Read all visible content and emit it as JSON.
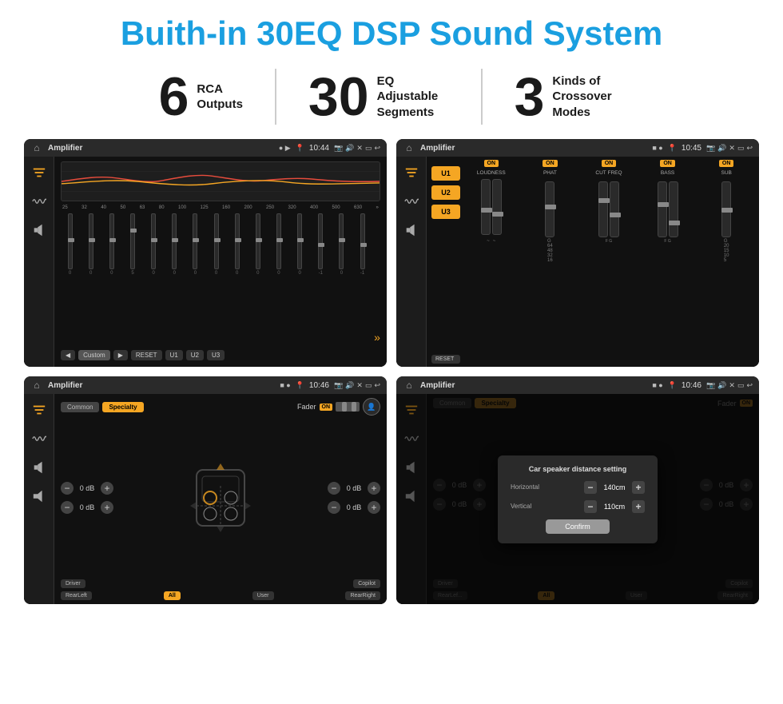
{
  "header": {
    "title": "Buith-in 30EQ DSP Sound System"
  },
  "stats": [
    {
      "number": "6",
      "label": "RCA\nOutputs"
    },
    {
      "number": "30",
      "label": "EQ Adjustable\nSegments"
    },
    {
      "number": "3",
      "label": "Kinds of\nCrossover Modes"
    }
  ],
  "screens": [
    {
      "id": "eq-screen",
      "status_bar": {
        "title": "Amplifier",
        "time": "10:44"
      },
      "eq_presets": [
        "Custom",
        "RESET",
        "U1",
        "U2",
        "U3"
      ],
      "freq_labels": [
        "25",
        "32",
        "40",
        "50",
        "63",
        "80",
        "100",
        "125",
        "160",
        "200",
        "250",
        "320",
        "400",
        "500",
        "630"
      ],
      "slider_values": [
        "0",
        "0",
        "0",
        "5",
        "0",
        "0",
        "0",
        "0",
        "0",
        "0",
        "0",
        "0",
        "-1",
        "0",
        "-1"
      ]
    },
    {
      "id": "crossover-screen",
      "status_bar": {
        "title": "Amplifier",
        "time": "10:45"
      },
      "presets": [
        "U1",
        "U2",
        "U3"
      ],
      "controls": [
        {
          "label": "LOUDNESS",
          "value": "ON"
        },
        {
          "label": "PHAT",
          "value": "ON"
        },
        {
          "label": "CUT FREQ",
          "value": "ON"
        },
        {
          "label": "BASS",
          "value": "ON"
        },
        {
          "label": "SUB",
          "value": "ON"
        }
      ],
      "reset_label": "RESET"
    },
    {
      "id": "fader-screen",
      "status_bar": {
        "title": "Amplifier",
        "time": "10:46"
      },
      "tabs": [
        "Common",
        "Specialty"
      ],
      "fader_label": "Fader",
      "fader_toggle": "ON",
      "speakers": [
        {
          "label": "0 dB"
        },
        {
          "label": "0 dB"
        },
        {
          "label": "0 dB"
        },
        {
          "label": "0 dB"
        }
      ],
      "buttons": {
        "driver": "Driver",
        "copilot": "Copilot",
        "rear_left": "RearLeft",
        "all": "All",
        "user": "User",
        "rear_right": "RearRight"
      }
    },
    {
      "id": "dialog-screen",
      "status_bar": {
        "title": "Amplifier",
        "time": "10:46"
      },
      "tabs": [
        "Common",
        "Specialty"
      ],
      "dialog": {
        "title": "Car speaker distance setting",
        "horizontal_label": "Horizontal",
        "horizontal_value": "140cm",
        "vertical_label": "Vertical",
        "vertical_value": "110cm",
        "confirm_label": "Confirm"
      },
      "buttons": {
        "driver": "Driver",
        "copilot": "Copilot",
        "rear_left": "RearLef...",
        "all": "All",
        "user": "User",
        "rear_right": "RearRight"
      }
    }
  ],
  "colors": {
    "accent": "#f5a623",
    "blue": "#1a9fe0",
    "dark_bg": "#111111",
    "panel_bg": "#1c1c1c"
  }
}
